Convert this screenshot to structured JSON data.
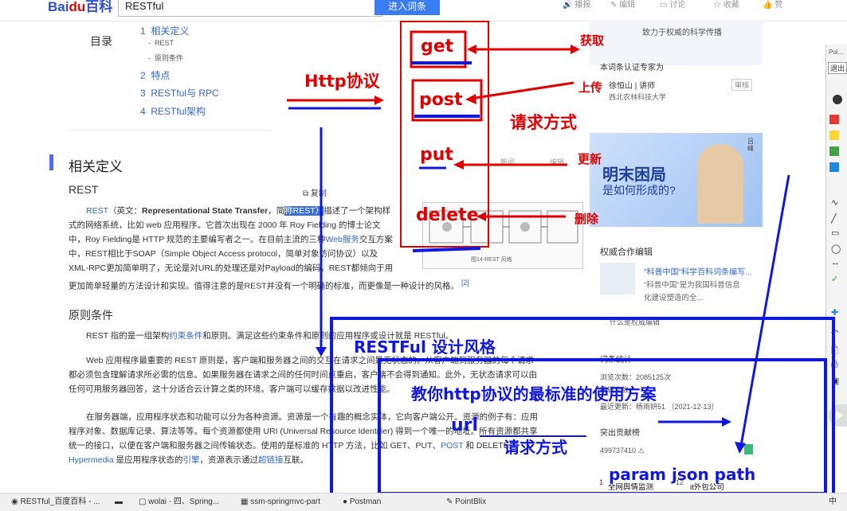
{
  "header": {
    "logo_text": "Bai",
    "logo_du": "du",
    "logo_baike": "百科",
    "search_value": "RESTful",
    "enter_button": "进入词条",
    "actions": [
      "播报",
      "编辑",
      "讨论",
      "收藏",
      "赞"
    ]
  },
  "toc": {
    "label": "目录",
    "items": [
      {
        "num": "1",
        "text": "相关定义"
      },
      {
        "num": "2",
        "text": "特点"
      },
      {
        "num": "3",
        "text": "RESTful与 RPC"
      },
      {
        "num": "4",
        "text": "RESTful架构"
      }
    ],
    "subitems": [
      "REST",
      "原则条件"
    ]
  },
  "article": {
    "section_title": "相关定义",
    "rest_heading": "REST",
    "copy_label": "复制",
    "p1": {
      "link": "REST",
      "pre": "（英文：",
      "bold": "Representational State Transfer",
      "mid": "，简",
      "selected": "称REST）",
      "post": "描述了一个架构样",
      "line2": "式的网络系统，比如 web 应用程序。它首次出现在 2000 年 Roy Fielding 的博士论文",
      "line3a": "中，Roy Fielding是 HTTP 规范的主要编写者之一。在目前主流的三种",
      "line3link": "Web服务",
      "line3b": "交互方案",
      "line4": "中，REST相比于SOAP（Simple Object Access protocol，简单对象访问协议）以及",
      "line5": "XML-RPC更加简单明了，无论是对URL的处理还是对Payload的编码，REST都倾向于用",
      "line6": "更加简单轻量的方法设计和实现。值得注意的是REST并没有一个明确的标准，而更像是一种设计的风格。",
      "ref": "[2]"
    },
    "principles_heading": "原则条件",
    "p2": {
      "a": "REST 指的是一组架构",
      "link": "约束条件",
      "b": "和原则。满足这些约束条件和原则的应用程序或设计就是 RESTful。"
    },
    "p3": {
      "line1": "Web 应用程序最重要的 REST 原则是，客户端和服务器之间的交互在请求之间是无状态的。从客户端到服务器的每个请求",
      "line2": "都必须包含理解请求所必需的信息。如果服务器在请求之间的任何时间点重启，客户端不会得到通知。此外，无状态请求可以由",
      "line3": "任何可用服务器回答，这十分适合云计算之类的环境。客户端可以缓存数据以改进性能。"
    },
    "p4": {
      "line1": "在服务器端，应用程序状态和功能可以分为各种资源。资源是一个有趣的概念实体，它向客户端公开。资源的例子有：应用",
      "line2": "程序对象、数据库记录、算法等等。每个资源都使用 URI (Universal Resource Identifier) 得到一个唯一的地址。所有资源都共享",
      "line3a": "统一的接口，以便在客户端和服务器之间传输状态。使用的是标准的 HTTP 方法，比如 GET、PUT、",
      "line3link": "POST",
      "line3b": " 和 DELETE。",
      "line4link": "Hypermedia",
      "line4a": " 是应用程序状态的",
      "line4link2": "引擎",
      "line4b": "，资源表示通过",
      "line4link3": "超链接",
      "line4c": "互联。"
    },
    "figure_caption": "图14-REST 风格",
    "inline_links": [
      "新闻",
      "编辑"
    ]
  },
  "sidebar_right": {
    "slogan": "致力于权威的科学传播",
    "expert_title": "本词条认证专家为",
    "expert_name": "徐恒山",
    "expert_role": "讲师",
    "expert_org": "西北农林科技大学",
    "expert_badge": "审核",
    "ad_title": "明末困局",
    "ad_sub": "是如何形成的?",
    "ad_tag": "吕峰",
    "partner_title": "权威合作编辑",
    "partner_name": "\"科普中国\"科学百科词条编写...",
    "partner_desc": "\"科普中国\"是为我国科普信息化建设塑造的全...",
    "partner_more": "什么是权威编辑",
    "stats_title": "词条统计",
    "views": "浏览次数：2085125次",
    "edits": "编辑次数：",
    "last_update": "最近更新：杨雨妍51 （2021-12-13）",
    "contrib_title": "突出贡献榜",
    "contrib_id": "499737410",
    "rank_items": [
      "全网舆情监测",
      "it外包公司"
    ],
    "rank_nums": [
      "1",
      "12"
    ]
  },
  "annotations": {
    "http": "Http协议",
    "get": "get",
    "post": "post",
    "put": "put",
    "delete": "delete",
    "fetch": "获取",
    "upload": "上传",
    "update": "更新",
    "remove": "删除",
    "request_method": "请求方式",
    "restful_style": "RESTFul 设计风格",
    "teach": "教你http协议的最标准的使用方案",
    "url": "url",
    "request_method2": "请求方式",
    "param": "param json path"
  },
  "taskbar": {
    "items": [
      "RESTful_百度百科 - ...",
      "",
      "wolai - 四、Spring...",
      "ssm-springmvc-part",
      "Postman",
      "PointBlix"
    ],
    "tray": [
      "中"
    ]
  },
  "side_panel": {
    "top_label": "Poi...",
    "exit_label": "退出"
  },
  "colors": {
    "baidu_blue": "#2e4fc9",
    "baidu_red": "#e10602",
    "link": "#3366cc",
    "anno_red": "#e00000",
    "anno_blue": "#1018e0"
  }
}
